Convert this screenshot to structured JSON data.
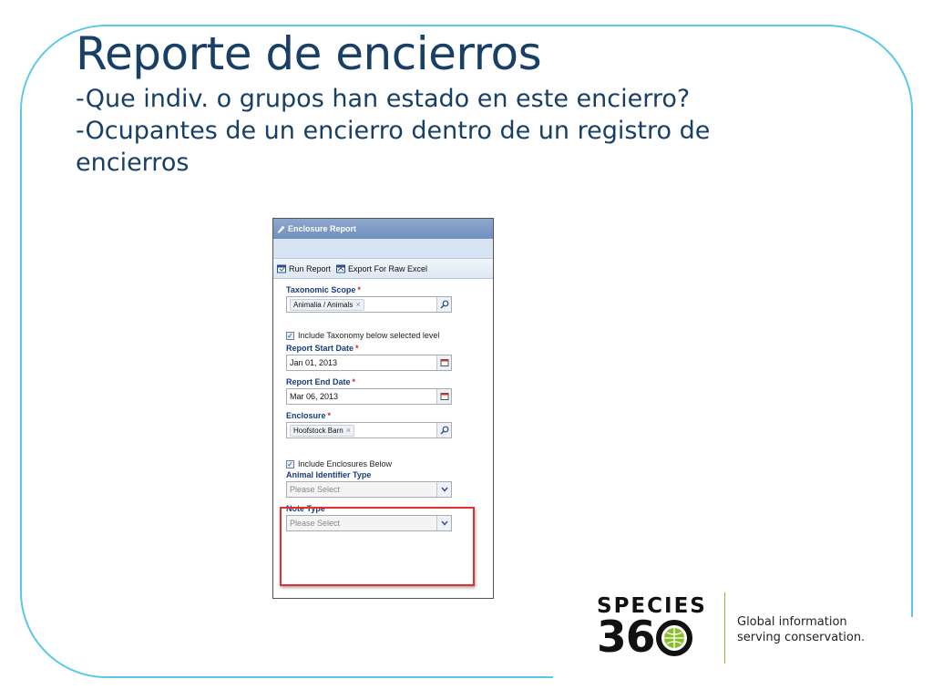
{
  "slide": {
    "title": "Reporte de encierros",
    "subtitle_lines": [
      "-Que indiv. o grupos han estado en este encierro?",
      "-Ocupantes de un encierro dentro de un registro de",
      "encierros"
    ]
  },
  "panel": {
    "header": "Enclosure Report",
    "toolbar": {
      "run_label": "Run Report",
      "export_label": "Export For Raw Excel"
    },
    "fields": {
      "taxonomic_scope": {
        "label": "Taxonomic Scope",
        "tag": "Animalia / Animals"
      },
      "include_taxonomy": "Include Taxonomy below selected level",
      "start_date": {
        "label": "Report Start Date",
        "value": "Jan 01, 2013"
      },
      "end_date": {
        "label": "Report End Date",
        "value": "Mar 06, 2013"
      },
      "enclosure": {
        "label": "Enclosure",
        "tag": "Hoofstock Barn"
      },
      "include_enclosures": "Include Enclosures Below",
      "identifier_type": {
        "label": "Animal Identifier Type",
        "placeholder": "Please Select"
      },
      "note_type": {
        "label": "Note Type",
        "placeholder": "Please Select"
      }
    },
    "required_mark": "*",
    "tag_remove": "×"
  },
  "logo": {
    "word": "SPECIES",
    "number_left": "36",
    "tagline_lines": [
      "Global information",
      "serving conservation."
    ]
  },
  "colors": {
    "title": "#183f66",
    "frame": "#5ac8e8",
    "highlight": "#e03030",
    "logo_accent": "#8bbf2a"
  }
}
